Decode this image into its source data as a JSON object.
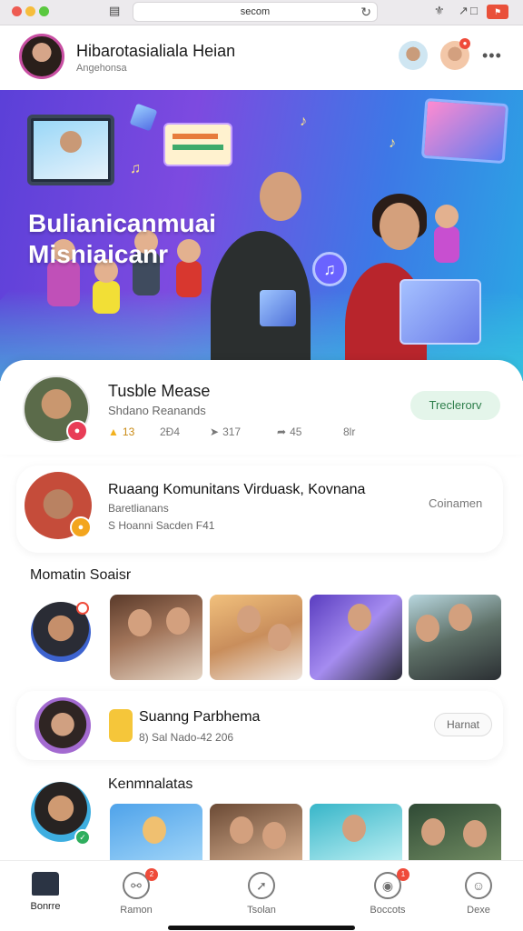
{
  "browser": {
    "url": "secom"
  },
  "header": {
    "title": "Hibarotasialiala Heian",
    "subtitle": "Angehonsa"
  },
  "hero": {
    "title_line1": "Bulianicanmuai",
    "title_line2": "Misniaicanr"
  },
  "card_featured": {
    "title": "Tusble Mease",
    "subtitle": "Shdano Reanands",
    "stats": [
      "13",
      "2Ð4",
      "317",
      "45",
      "8lr"
    ],
    "action": "Treclerorv"
  },
  "card_community": {
    "title": "Ruaang Komunitans Virduask, Kovnana",
    "subtitle1": "Baretlianans",
    "subtitle2": "S Hoanni Sacden F41",
    "action": "Coinamen"
  },
  "section_moments": {
    "title": "Momatin Soaisr"
  },
  "card_event": {
    "title": "Suanng Parbhema",
    "subtitle": "8) Sal Nado-42 206",
    "action": "Harnat"
  },
  "section_recommend": {
    "title": "Kenmnalatas"
  },
  "tabbar": {
    "items": [
      {
        "label": "Bonrre",
        "icon": "home-icon",
        "badge": ""
      },
      {
        "label": "Ramon",
        "icon": "chat-icon",
        "badge": "2"
      },
      {
        "label": "Tsolan",
        "icon": "compass-icon",
        "badge": ""
      },
      {
        "label": "Boccots",
        "icon": "notification-icon",
        "badge": "1"
      },
      {
        "label": "Dexe",
        "icon": "profile-icon",
        "badge": ""
      }
    ]
  },
  "colors": {
    "accent_pink": "#c84ea2",
    "badge_red": "#ef4b3a",
    "green_pill": "#e4f5ea",
    "hero_start": "#5b40d8",
    "hero_end": "#2aa7e4"
  }
}
